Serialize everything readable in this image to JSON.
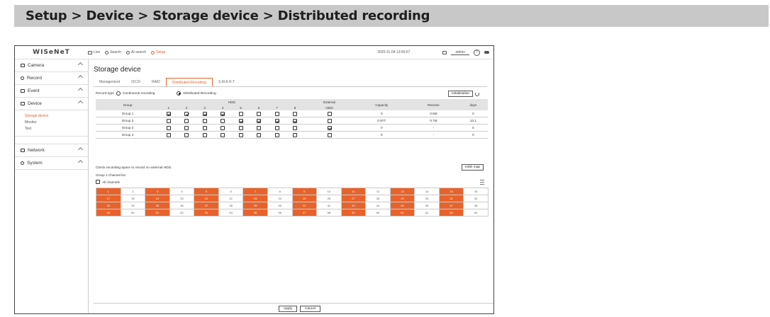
{
  "banner": {
    "text": "Setup > Device > Storage device > Distributed recording"
  },
  "topbar": {
    "logo": "WISeNeT",
    "menu": [
      {
        "label": "Live",
        "icon": "monitor-icon"
      },
      {
        "label": "Search",
        "icon": "search-icon"
      },
      {
        "label": "AI search",
        "icon": "ai-search-icon"
      },
      {
        "label": "Setup",
        "icon": "gear-icon",
        "active": true
      }
    ],
    "datetime": "2020-11-04 13:50:57",
    "user": "admin",
    "help": "?"
  },
  "sidebar": {
    "items": [
      {
        "label": "Camera",
        "icon": "camera-icon"
      },
      {
        "label": "Record",
        "icon": "record-icon"
      },
      {
        "label": "Event",
        "icon": "event-icon"
      },
      {
        "label": "Device",
        "icon": "device-icon"
      },
      {
        "label": "Network",
        "icon": "network-icon"
      },
      {
        "label": "System",
        "icon": "system-icon"
      }
    ],
    "device_sub": [
      "Storage device",
      "Monitor",
      "Text"
    ]
  },
  "main": {
    "title": "Storage device",
    "tabs": [
      "Management",
      "iSCSI",
      "RAID",
      "Distributed Recording",
      "S.M.A.R.T"
    ],
    "active_tab": "Distributed Recording",
    "record_type_label": "Record type",
    "record_options": [
      "Continuous recording",
      "Distributed Recording"
    ],
    "initialization_btn": "Initialization",
    "table": {
      "headers": {
        "group": "Group",
        "hdd": "HDD",
        "external": "External",
        "capacity": "Capacity",
        "receive": "Receive",
        "days": "days"
      },
      "hdd_cols": [
        "1",
        "2",
        "3",
        "4",
        "5",
        "6",
        "7",
        "8"
      ],
      "external_sub": "ODD",
      "rows": [
        {
          "name": "Group 1",
          "hdd": [
            true,
            true,
            true,
            true,
            false,
            false,
            false,
            false
          ],
          "ext": false,
          "capacity": "0",
          "receive": "0.5M",
          "days": "0"
        },
        {
          "name": "Group 2",
          "hdd": [
            false,
            false,
            false,
            false,
            true,
            true,
            true,
            true
          ],
          "ext": false,
          "capacity": "0.9TT",
          "receive": "0.7M",
          "days": "13.1"
        },
        {
          "name": "Group 3",
          "hdd": [
            false,
            false,
            false,
            false,
            false,
            false,
            false,
            false
          ],
          "ext": true,
          "capacity": "0",
          "receive": "-",
          "days": "0"
        },
        {
          "name": "Group 4",
          "hdd": [
            false,
            false,
            false,
            false,
            false,
            false,
            false,
            false
          ],
          "ext": false,
          "capacity": "0",
          "receive": "-",
          "days": "0"
        }
      ]
    },
    "note": "Check recording space to record on external HDD.",
    "hdd_map_btn": "HDD map",
    "channel_list_title": "Group 1 Channel list",
    "all_channels": "All channels",
    "channels_on": [
      1,
      3,
      5,
      7,
      9,
      11,
      13,
      15,
      17,
      19,
      21,
      23,
      25,
      27,
      29,
      31,
      33,
      35,
      37,
      39,
      41,
      43,
      45,
      47,
      49,
      51,
      53,
      55,
      57,
      59,
      61,
      63
    ],
    "channel_labels": [
      "1",
      "2",
      "3",
      "4",
      "5",
      "6",
      "7",
      "8",
      "9",
      "10",
      "11",
      "12",
      "13",
      "14",
      "15",
      "16",
      "17",
      "18",
      "19",
      "20",
      "21",
      "22",
      "23",
      "24",
      "25",
      "26",
      "27",
      "28",
      "29",
      "30",
      "31",
      "32",
      "33",
      "34",
      "35",
      "36",
      "37",
      "38",
      "39",
      "40",
      "41",
      "42",
      "43",
      "44",
      "45",
      "46",
      "47",
      "48",
      "49",
      "50",
      "51",
      "52",
      "53",
      "54",
      "55",
      "56",
      "57",
      "58",
      "59",
      "60",
      "61",
      "62",
      "63",
      "64"
    ],
    "apply": "Apply",
    "cancel": "Cancel"
  },
  "colors": {
    "accent": "#e8632b",
    "banner": "#c8c8c8"
  }
}
